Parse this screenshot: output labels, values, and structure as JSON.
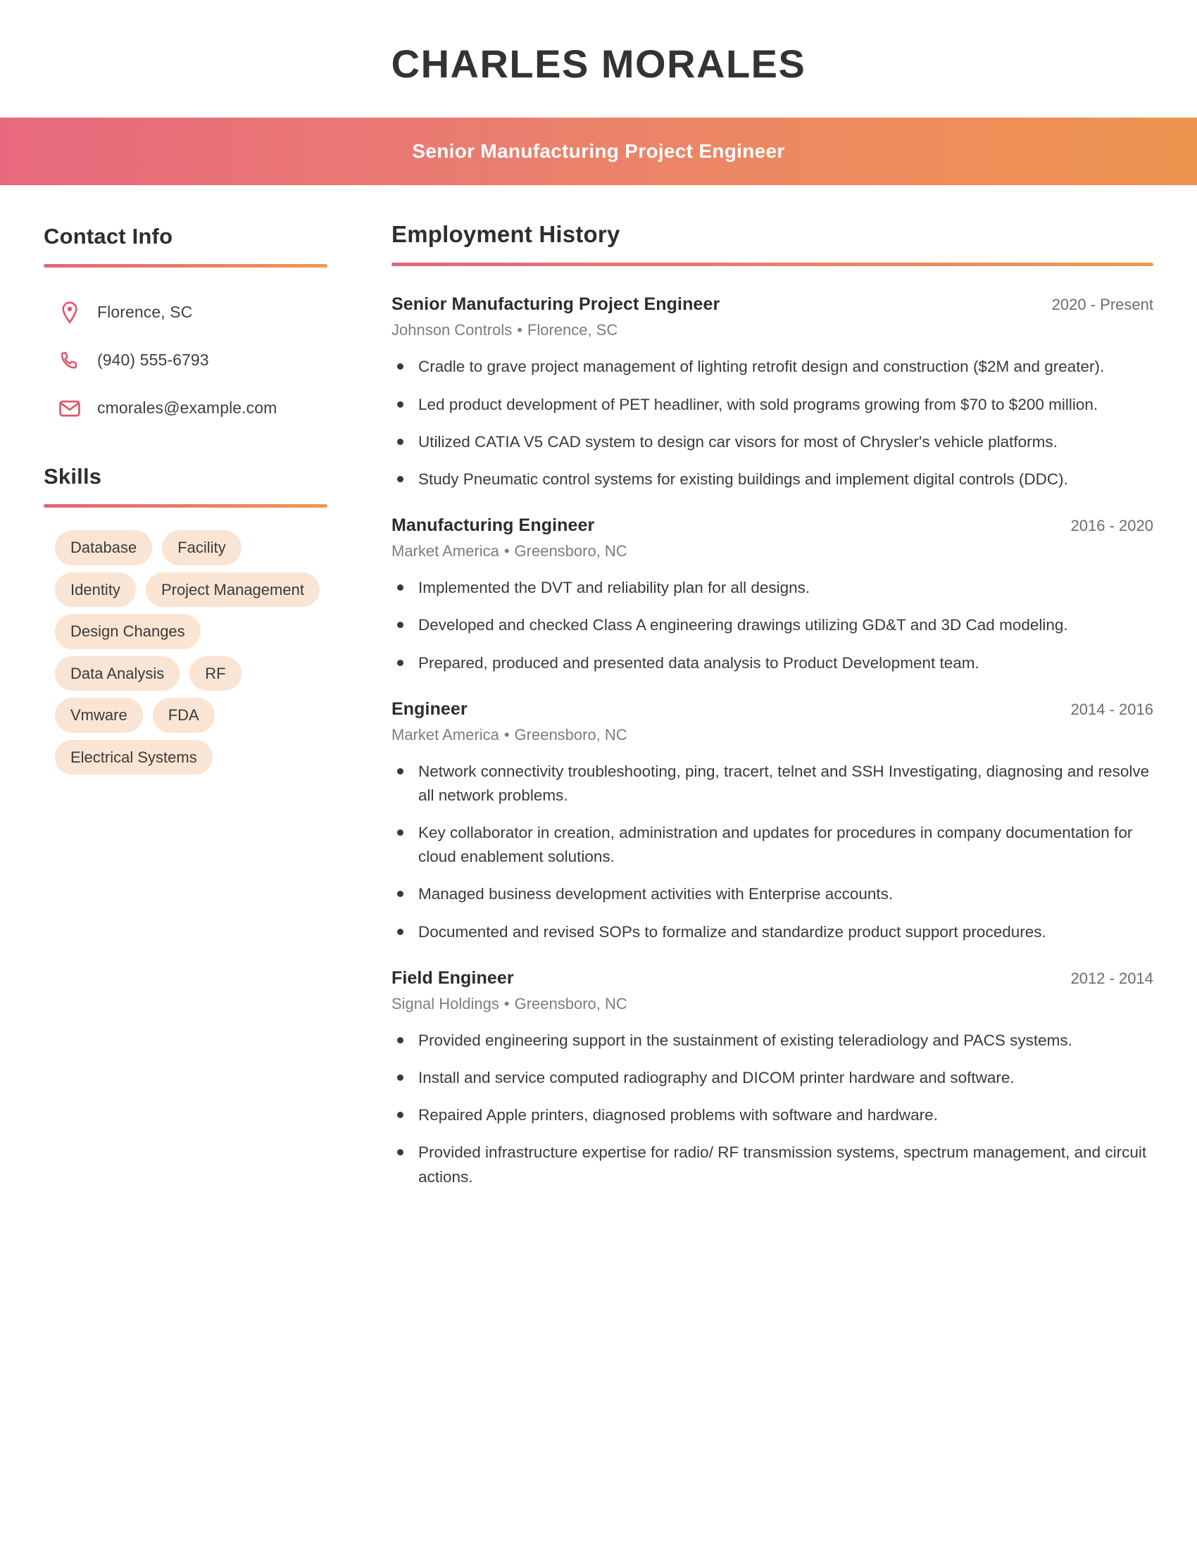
{
  "header": {
    "name": "CHARLES MORALES",
    "title": "Senior Manufacturing Project Engineer"
  },
  "theme": {
    "gradient_start": "#e8697d",
    "gradient_end": "#ee9450",
    "pill_background": "#fae4d3",
    "icon_color": "#e0556c",
    "heading_color": "#2e2e2e"
  },
  "sidebar": {
    "contact": {
      "heading": "Contact Info",
      "items": [
        {
          "icon": "location-pin-icon",
          "value": "Florence, SC"
        },
        {
          "icon": "phone-icon",
          "value": "(940) 555-6793"
        },
        {
          "icon": "envelope-icon",
          "value": "cmorales@example.com"
        }
      ]
    },
    "skills": {
      "heading": "Skills",
      "items": [
        "Database",
        "Facility",
        "Identity",
        "Project Management",
        "Design Changes",
        "Data Analysis",
        "RF",
        "Vmware",
        "FDA",
        "Electrical Systems"
      ]
    }
  },
  "main": {
    "employment": {
      "heading": "Employment History",
      "jobs": [
        {
          "title": "Senior Manufacturing Project Engineer",
          "dates": "2020 - Present",
          "company": "Johnson Controls",
          "location": "Florence, SC",
          "bullets": [
            "Cradle to grave project management of lighting retrofit design and construction ($2M and greater).",
            "Led product development of PET headliner, with sold programs growing from $70 to $200 million.",
            "Utilized CATIA V5 CAD system to design car visors for most of Chrysler's vehicle platforms.",
            "Study Pneumatic control systems for existing buildings and implement digital controls (DDC)."
          ]
        },
        {
          "title": "Manufacturing Engineer",
          "dates": "2016 - 2020",
          "company": "Market America",
          "location": "Greensboro, NC",
          "bullets": [
            "Implemented the DVT and reliability plan for all designs.",
            "Developed and checked Class A engineering drawings utilizing GD&T and 3D Cad modeling.",
            "Prepared, produced and presented data analysis to Product Development team."
          ]
        },
        {
          "title": "Engineer",
          "dates": "2014 - 2016",
          "company": "Market America",
          "location": "Greensboro, NC",
          "bullets": [
            "Network connectivity troubleshooting, ping, tracert, telnet and SSH Investigating, diagnosing and resolve all network problems.",
            "Key collaborator in creation, administration and updates for procedures in company documentation for cloud enablement solutions.",
            "Managed business development activities with Enterprise accounts.",
            "Documented and revised SOPs to formalize and standardize product support procedures."
          ]
        },
        {
          "title": "Field Engineer",
          "dates": "2012 - 2014",
          "company": "Signal Holdings",
          "location": "Greensboro, NC",
          "bullets": [
            "Provided engineering support in the sustainment of existing teleradiology and PACS systems.",
            "Install and service computed radiography and DICOM printer hardware and software.",
            "Repaired Apple printers, diagnosed problems with software and hardware.",
            "Provided infrastructure expertise for radio/ RF transmission systems, spectrum management, and circuit actions."
          ]
        }
      ],
      "separator": "•"
    }
  }
}
